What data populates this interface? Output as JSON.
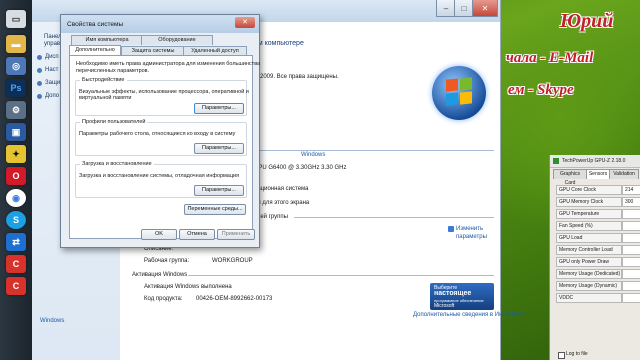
{
  "taskbar": {
    "icons": [
      "computer-icon",
      "folder-icon",
      "network-icon",
      "photoshop-icon",
      "settings-icon",
      "virtualbox-icon",
      "batman-icon",
      "opera-icon",
      "chrome-icon",
      "skype-icon",
      "teamviewer-icon",
      "ccleaner-icon",
      "ccleaner2-icon"
    ],
    "photoshop_label": "Ps",
    "skype_label": "S",
    "ccleaner_label": "C"
  },
  "syswin": {
    "leftpane": {
      "item1": "Панел",
      "item2": "управ",
      "links": [
        "Дисп",
        "Наст",
        "Защи",
        "Допо"
      ]
    },
    "header": "ем компьютере",
    "copyright": "2009. Все права защищены.",
    "section_rating": "Windows",
    "cpu": "CPU G6400 @ 3.30GHz   3.30 GHz",
    "os_type": "рационная система",
    "pen": "ен для этого экрана",
    "workgroup_heading": "очей группы",
    "change_settings": "Изменить параметры",
    "description_label": "Описание:",
    "workgroup_label": "Рабочая группа:",
    "workgroup_value": "WORKGROUP",
    "activation_heading": "Активация Windows",
    "activation_status": "Активация Windows выполнена",
    "product_key_label": "Код продукта:",
    "product_key_value": "00426-OEM-8992662-00173",
    "genuine_badge_line1": "Выберите",
    "genuine_badge_line2": "настоящее",
    "genuine_badge_line3": "программное обеспечение",
    "genuine_badge_line4": "Microsoft",
    "more_info_link": "Дополнительные сведения в Интернете",
    "see_also": "Windows"
  },
  "dialog": {
    "title": "Свойства системы",
    "tabs_row1": [
      "Имя компьютера",
      "Оборудование"
    ],
    "tabs_row2": [
      "Дополнительно",
      "Защита системы",
      "Удаленный доступ"
    ],
    "admin_note_line1": "Необходимо иметь права администратора для изменения большинства",
    "admin_note_line2": "перечисленных параметров.",
    "perf_title": "Быстродействие",
    "perf_text_line1": "Визуальные эффекты, использование процессора, оперативной и",
    "perf_text_line2": "виртуальной памяти",
    "perf_button": "Параметры...",
    "profiles_title": "Профили пользователей",
    "profiles_text": "Параметры рабочего стола, относящиеся ко входу в систему",
    "profiles_button": "Параметры...",
    "startup_title": "Загрузка и восстановление",
    "startup_text": "Загрузка и восстановление системы, отладочная информация",
    "startup_button": "Параметры...",
    "env_button": "Переменные среды...",
    "ok": "OK",
    "cancel": "Отмена",
    "apply": "Применить"
  },
  "overlay": {
    "name": "Юрий",
    "line1": "чала - E-Mail",
    "line2": "ем  -  Skype"
  },
  "gpuz": {
    "title": "TechPowerUp GPU-Z 2.18.0",
    "tabs": [
      "Graphics Card",
      "Sensors",
      "Validation"
    ],
    "rows": [
      {
        "label": "GPU Core Clock",
        "value": "214"
      },
      {
        "label": "GPU Memory Clock",
        "value": "300"
      },
      {
        "label": "GPU Temperature",
        "value": ""
      },
      {
        "label": "Fan Speed (%)",
        "value": ""
      },
      {
        "label": "GPU Load",
        "value": ""
      },
      {
        "label": "Memory Controller Load",
        "value": ""
      },
      {
        "label": "GPU only Power Draw",
        "value": ""
      },
      {
        "label": "Memory Usage (Dedicated)",
        "value": ""
      },
      {
        "label": "Memory Usage (Dynamic)",
        "value": ""
      },
      {
        "label": "VDDC",
        "value": ""
      }
    ],
    "log_label": "Log to file"
  }
}
